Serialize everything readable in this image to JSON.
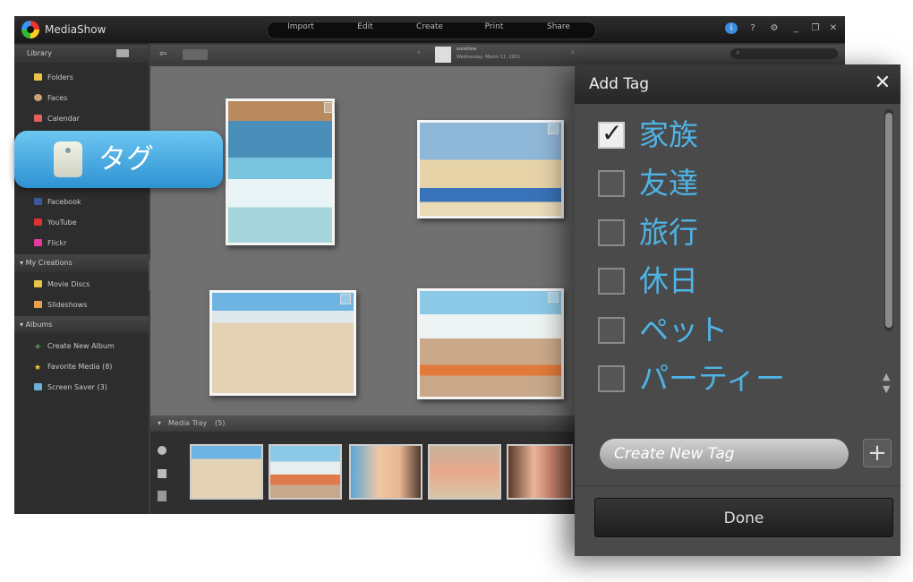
{
  "app": {
    "name": "MediaShow",
    "menu": [
      "Import",
      "Edit",
      "Create",
      "Print",
      "Share"
    ],
    "window_controls": [
      "i",
      "?",
      "⚙",
      "_",
      "❐",
      "✕"
    ]
  },
  "sidebar": {
    "library_header": "Library",
    "library_items": [
      {
        "label": "Folders",
        "icon": "folder-icon"
      },
      {
        "label": "Faces",
        "icon": "faces-icon"
      },
      {
        "label": "Calendar",
        "icon": "calendar-icon"
      }
    ],
    "hidden_items": [
      {
        "label": "Facebook",
        "icon": "facebook-icon"
      },
      {
        "label": "YouTube",
        "icon": "youtube-icon"
      },
      {
        "label": "Flickr",
        "icon": "flickr-icon"
      }
    ],
    "creations_header": "My Creations",
    "creations_items": [
      {
        "label": "Movie Discs",
        "icon": "disc-icon"
      },
      {
        "label": "Slideshows",
        "icon": "slideshow-icon"
      }
    ],
    "albums_header": "Albums",
    "album_items": [
      {
        "label": "Create New Album",
        "icon": "plus-icon"
      },
      {
        "label": "Favorite Media (8)",
        "icon": "star-icon"
      },
      {
        "label": "Screen Saver (3)",
        "icon": "screen-icon"
      }
    ]
  },
  "viewer": {
    "user_name": "sunshine",
    "date_text": "Wednesday, March 11, 2011"
  },
  "tray": {
    "title": "Media Tray",
    "count": "(5)"
  },
  "callout": {
    "label": "タグ"
  },
  "dialog": {
    "title": "Add Tag",
    "close": "✕",
    "tags": [
      {
        "label": "家族",
        "checked": true
      },
      {
        "label": "友達",
        "checked": false
      },
      {
        "label": "旅行",
        "checked": false
      },
      {
        "label": "休日",
        "checked": false
      },
      {
        "label": "ペット",
        "checked": false
      },
      {
        "label": "パーティー",
        "checked": false
      }
    ],
    "new_tag_placeholder": "Create New Tag",
    "add_button": "+",
    "done_button": "Done"
  },
  "colors": {
    "tag_text": "#4fb3e6",
    "callout": "#3ea6e0",
    "dialog_bg": "#4a4a4a"
  }
}
